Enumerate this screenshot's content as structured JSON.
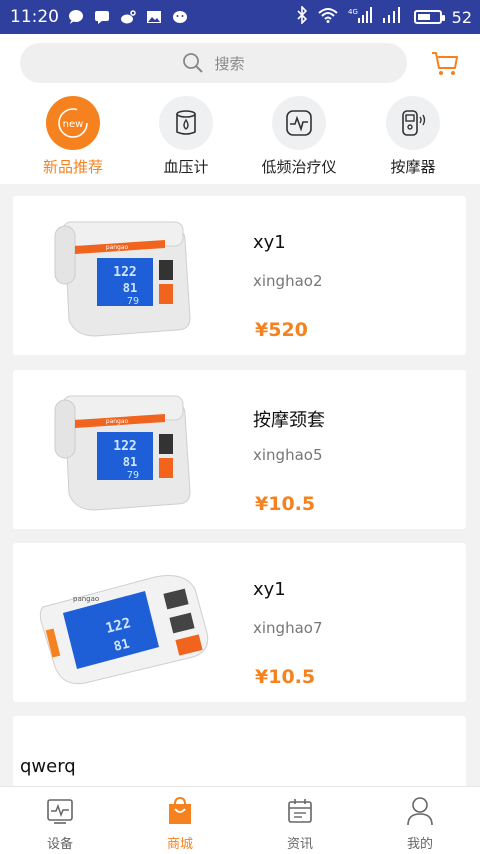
{
  "status_bar": {
    "time": "11:20",
    "battery": "52"
  },
  "search": {
    "placeholder": "搜索"
  },
  "categories": [
    {
      "label": "新品推荐",
      "icon": "new-icon",
      "badge": "new"
    },
    {
      "label": "血压计",
      "icon": "blood-pressure-icon"
    },
    {
      "label": "低频治疗仪",
      "icon": "pulse-device-icon"
    },
    {
      "label": "按摩器",
      "icon": "massager-icon"
    }
  ],
  "products": [
    {
      "title": "xy1",
      "model": "xinghao2",
      "price": "¥520"
    },
    {
      "title": "按摩颈套",
      "model": "xinghao5",
      "price": "¥10.5"
    },
    {
      "title": "xy1",
      "model": "xinghao7",
      "price": "¥10.5"
    },
    {
      "title": "qwerq"
    }
  ],
  "device_screen": {
    "readings": [
      "122",
      "81",
      "79"
    ],
    "brand": "pangao"
  },
  "tabs": [
    {
      "label": "设备",
      "icon": "device-icon"
    },
    {
      "label": "商城",
      "icon": "shopping-bag-icon"
    },
    {
      "label": "资讯",
      "icon": "news-icon"
    },
    {
      "label": "我的",
      "icon": "profile-icon"
    }
  ],
  "colors": {
    "accent": "#f5821f",
    "status_bar": "#2e3f9e"
  }
}
